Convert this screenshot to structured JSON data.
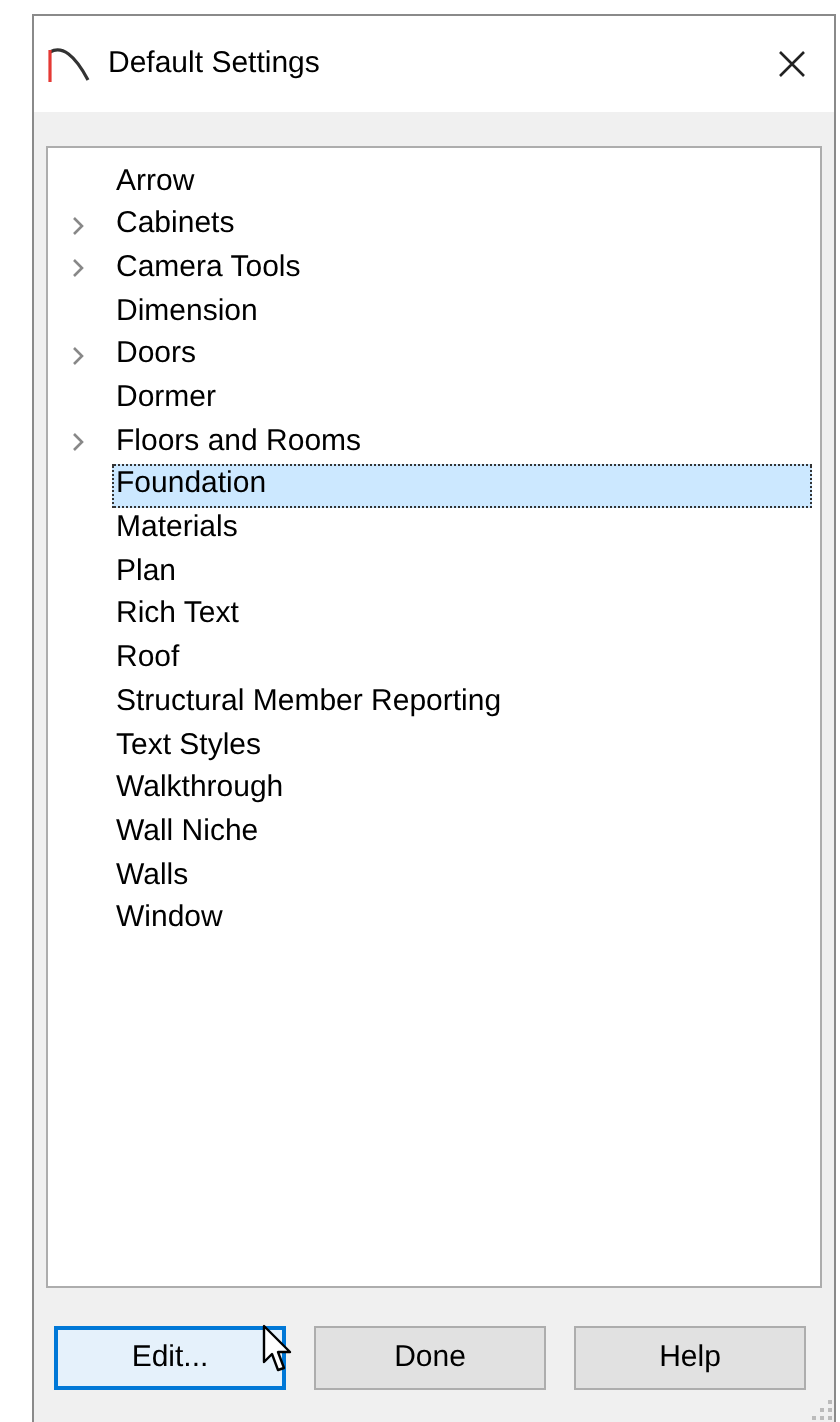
{
  "window": {
    "title": "Default Settings"
  },
  "tree": {
    "items": [
      {
        "label": "Arrow",
        "expandable": false,
        "selected": false
      },
      {
        "label": "Cabinets",
        "expandable": true,
        "selected": false
      },
      {
        "label": "Camera Tools",
        "expandable": true,
        "selected": false
      },
      {
        "label": "Dimension",
        "expandable": false,
        "selected": false
      },
      {
        "label": "Doors",
        "expandable": true,
        "selected": false
      },
      {
        "label": "Dormer",
        "expandable": false,
        "selected": false
      },
      {
        "label": "Floors and Rooms",
        "expandable": true,
        "selected": false
      },
      {
        "label": "Foundation",
        "expandable": false,
        "selected": true
      },
      {
        "label": "Materials",
        "expandable": false,
        "selected": false
      },
      {
        "label": "Plan",
        "expandable": false,
        "selected": false
      },
      {
        "label": "Rich Text",
        "expandable": false,
        "selected": false
      },
      {
        "label": "Roof",
        "expandable": false,
        "selected": false
      },
      {
        "label": "Structural Member Reporting",
        "expandable": false,
        "selected": false
      },
      {
        "label": "Text Styles",
        "expandable": false,
        "selected": false
      },
      {
        "label": "Walkthrough",
        "expandable": false,
        "selected": false
      },
      {
        "label": "Wall Niche",
        "expandable": false,
        "selected": false
      },
      {
        "label": "Walls",
        "expandable": false,
        "selected": false
      },
      {
        "label": "Window",
        "expandable": false,
        "selected": false
      }
    ]
  },
  "buttons": [
    {
      "label": "Edit...",
      "focused": true,
      "hovered": true
    },
    {
      "label": "Done",
      "focused": false,
      "hovered": false
    },
    {
      "label": "Help",
      "focused": false,
      "hovered": false
    }
  ]
}
